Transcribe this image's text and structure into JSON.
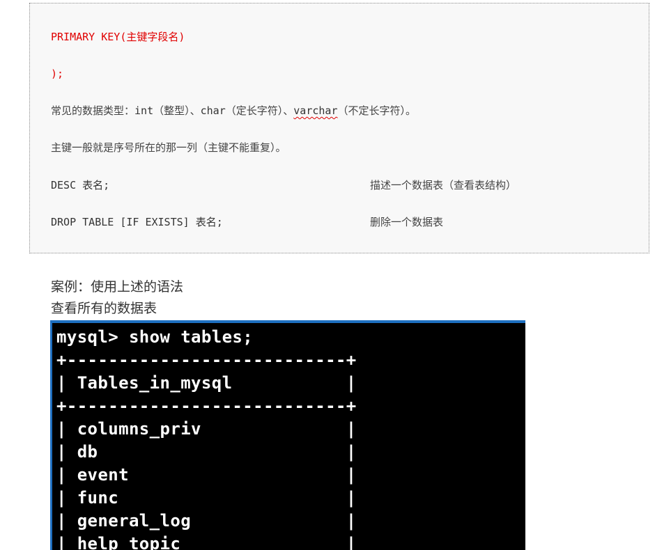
{
  "code": {
    "line_primary_key": "PRIMARY KEY(主键字段名)",
    "line_close": ");",
    "line_types_prefix": "常见的数据类型：",
    "line_types_int": "int",
    "line_types_int_cn": "（整型）、",
    "line_types_char": "char",
    "line_types_char_cn": "（定长字符）、",
    "line_types_varchar": "varchar",
    "line_types_varchar_cn": "（不定长字符）。",
    "line_pk_note": "主键一般就是序号所在的那一列（主键不能重复）。",
    "line_desc_cmd": "DESC 表名;",
    "line_desc_text": "描述一个数据表（查看表结构）",
    "line_drop_cmd": "DROP TABLE [IF EXISTS] 表名;",
    "line_drop_text": "删除一个数据表"
  },
  "paragraph": {
    "case": "案例：使用上述的语法",
    "view_all": "查看所有的数据表"
  },
  "terminal": {
    "lines": [
      "mysql> show tables;",
      "+---------------------------+",
      "| Tables_in_mysql           |",
      "+---------------------------+",
      "| columns_priv              |",
      "| db                        |",
      "| event                     |",
      "| func                      |",
      "| general_log               |",
      "| help_topic                |"
    ]
  },
  "colors": {
    "keyword_red": "#e00000",
    "terminal_bg": "#000000",
    "terminal_border": "#1e6fc0"
  }
}
